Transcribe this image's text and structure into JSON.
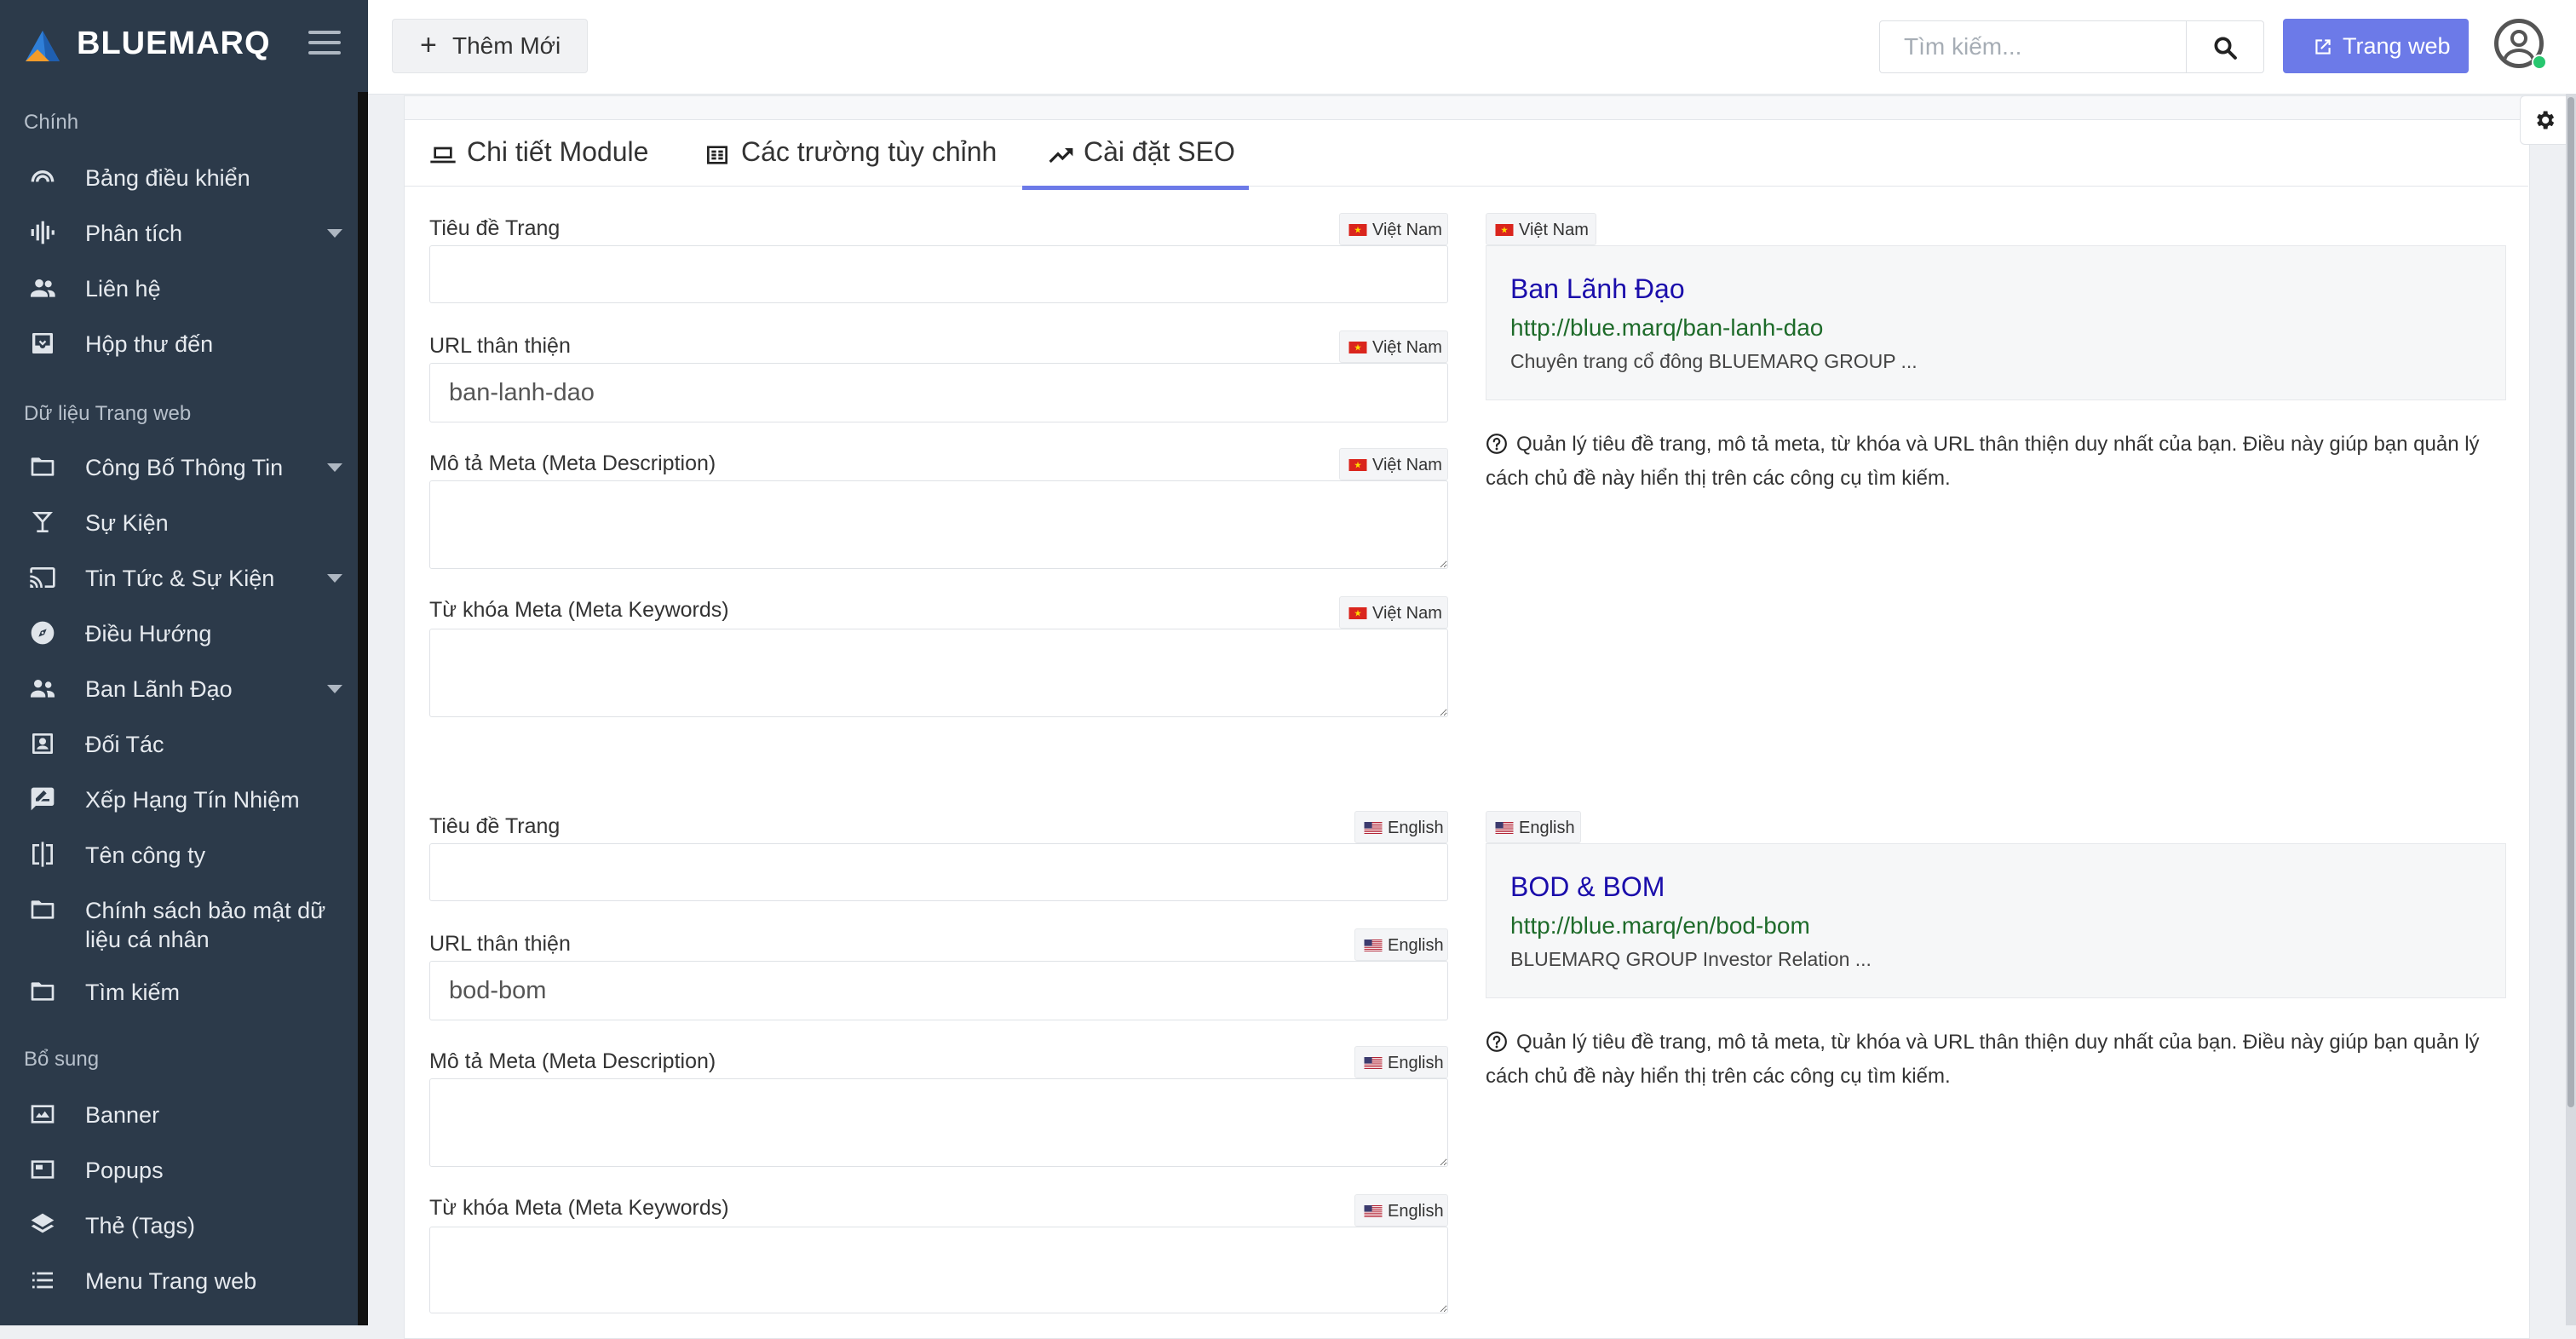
{
  "brand": {
    "name": "BLUEMARQ"
  },
  "sidebar": {
    "sections": [
      "Chính",
      "Dữ liệu Trang web",
      "Bổ sung"
    ],
    "items": [
      {
        "label": "Bảng điều khiển",
        "icon": "gauge-icon"
      },
      {
        "label": "Phân tích",
        "icon": "waveform-icon",
        "has_submenu": true
      },
      {
        "label": "Liên hệ",
        "icon": "users-icon"
      },
      {
        "label": "Hộp thư đến",
        "icon": "inbox-icon"
      },
      {
        "label": "Công Bố Thông Tin",
        "icon": "folder-icon",
        "has_submenu": true
      },
      {
        "label": "Sự Kiện",
        "icon": "glass-icon"
      },
      {
        "label": "Tin Tức & Sự Kiện",
        "icon": "cast-icon",
        "has_submenu": true
      },
      {
        "label": "Điều Hướng",
        "icon": "compass-icon"
      },
      {
        "label": "Ban Lãnh Đạo",
        "icon": "people-icon",
        "has_submenu": true
      },
      {
        "label": "Đối Tác",
        "icon": "contact-card-icon"
      },
      {
        "label": "Xếp Hạng Tín Nhiệm",
        "icon": "rate-review-icon"
      },
      {
        "label": "Tên công ty",
        "icon": "split-icon"
      },
      {
        "label": "Chính sách bảo mật dữ",
        "label2": "liệu cá nhân",
        "icon": "folder-icon"
      },
      {
        "label": "Tìm kiếm",
        "icon": "folder-icon"
      },
      {
        "label": "Banner",
        "icon": "banner-icon"
      },
      {
        "label": "Popups",
        "icon": "popup-icon"
      },
      {
        "label": "Thẻ (Tags)",
        "icon": "layers-icon"
      },
      {
        "label": "Menu Trang web",
        "icon": "list-icon"
      }
    ]
  },
  "topbar": {
    "add_label": "Thêm Mới",
    "search_placeholder": "Tìm kiếm...",
    "website_label": "Trang web"
  },
  "tabs": [
    {
      "label": "Chi tiết Module",
      "icon": "laptop-icon"
    },
    {
      "label": "Các trường tùy chỉnh",
      "icon": "custom-fields-icon"
    },
    {
      "label": "Cài đặt SEO",
      "icon": "trending-up-icon",
      "active": true
    }
  ],
  "seo": [
    {
      "language": "Việt Nam",
      "flag": "vn",
      "fields": {
        "page_title_label": "Tiêu đề Trang",
        "page_title_value": "",
        "url_label": "URL thân thiện",
        "url_value": "ban-lanh-dao",
        "desc_label": "Mô tả Meta (Meta Description)",
        "desc_value": "",
        "keywords_label": "Từ khóa Meta (Meta Keywords)",
        "keywords_value": ""
      },
      "preview": {
        "title": "Ban Lãnh Đạo",
        "url": "http://blue.marq/ban-lanh-dao",
        "desc": "Chuyên trang cổ đông BLUEMARQ GROUP ..."
      },
      "note": "Quản lý tiêu đề trang, mô tả meta, từ khóa và URL thân thiện duy nhất của bạn. Điều này giúp bạn quản lý cách chủ đề này hiển thị trên các công cụ tìm kiếm."
    },
    {
      "language": "English",
      "flag": "us",
      "fields": {
        "page_title_label": "Tiêu đề Trang",
        "page_title_value": "",
        "url_label": "URL thân thiện",
        "url_value": "bod-bom",
        "desc_label": "Mô tả Meta (Meta Description)",
        "desc_value": "",
        "keywords_label": "Từ khóa Meta (Meta Keywords)",
        "keywords_value": ""
      },
      "preview": {
        "title": "BOD & BOM",
        "url": "http://blue.marq/en/bod-bom",
        "desc": "BLUEMARQ GROUP Investor Relation ..."
      },
      "note": "Quản lý tiêu đề trang, mô tả meta, từ khóa và URL thân thiện duy nhất của bạn. Điều này giúp bạn quản lý cách chủ đề này hiển thị trên các công cụ tìm kiếm."
    }
  ],
  "colors": {
    "sidebar_bg": "#2c3a4a",
    "accent": "#6c7ae8",
    "link_title": "#1a0dab",
    "link_url": "#1e6b2a"
  }
}
